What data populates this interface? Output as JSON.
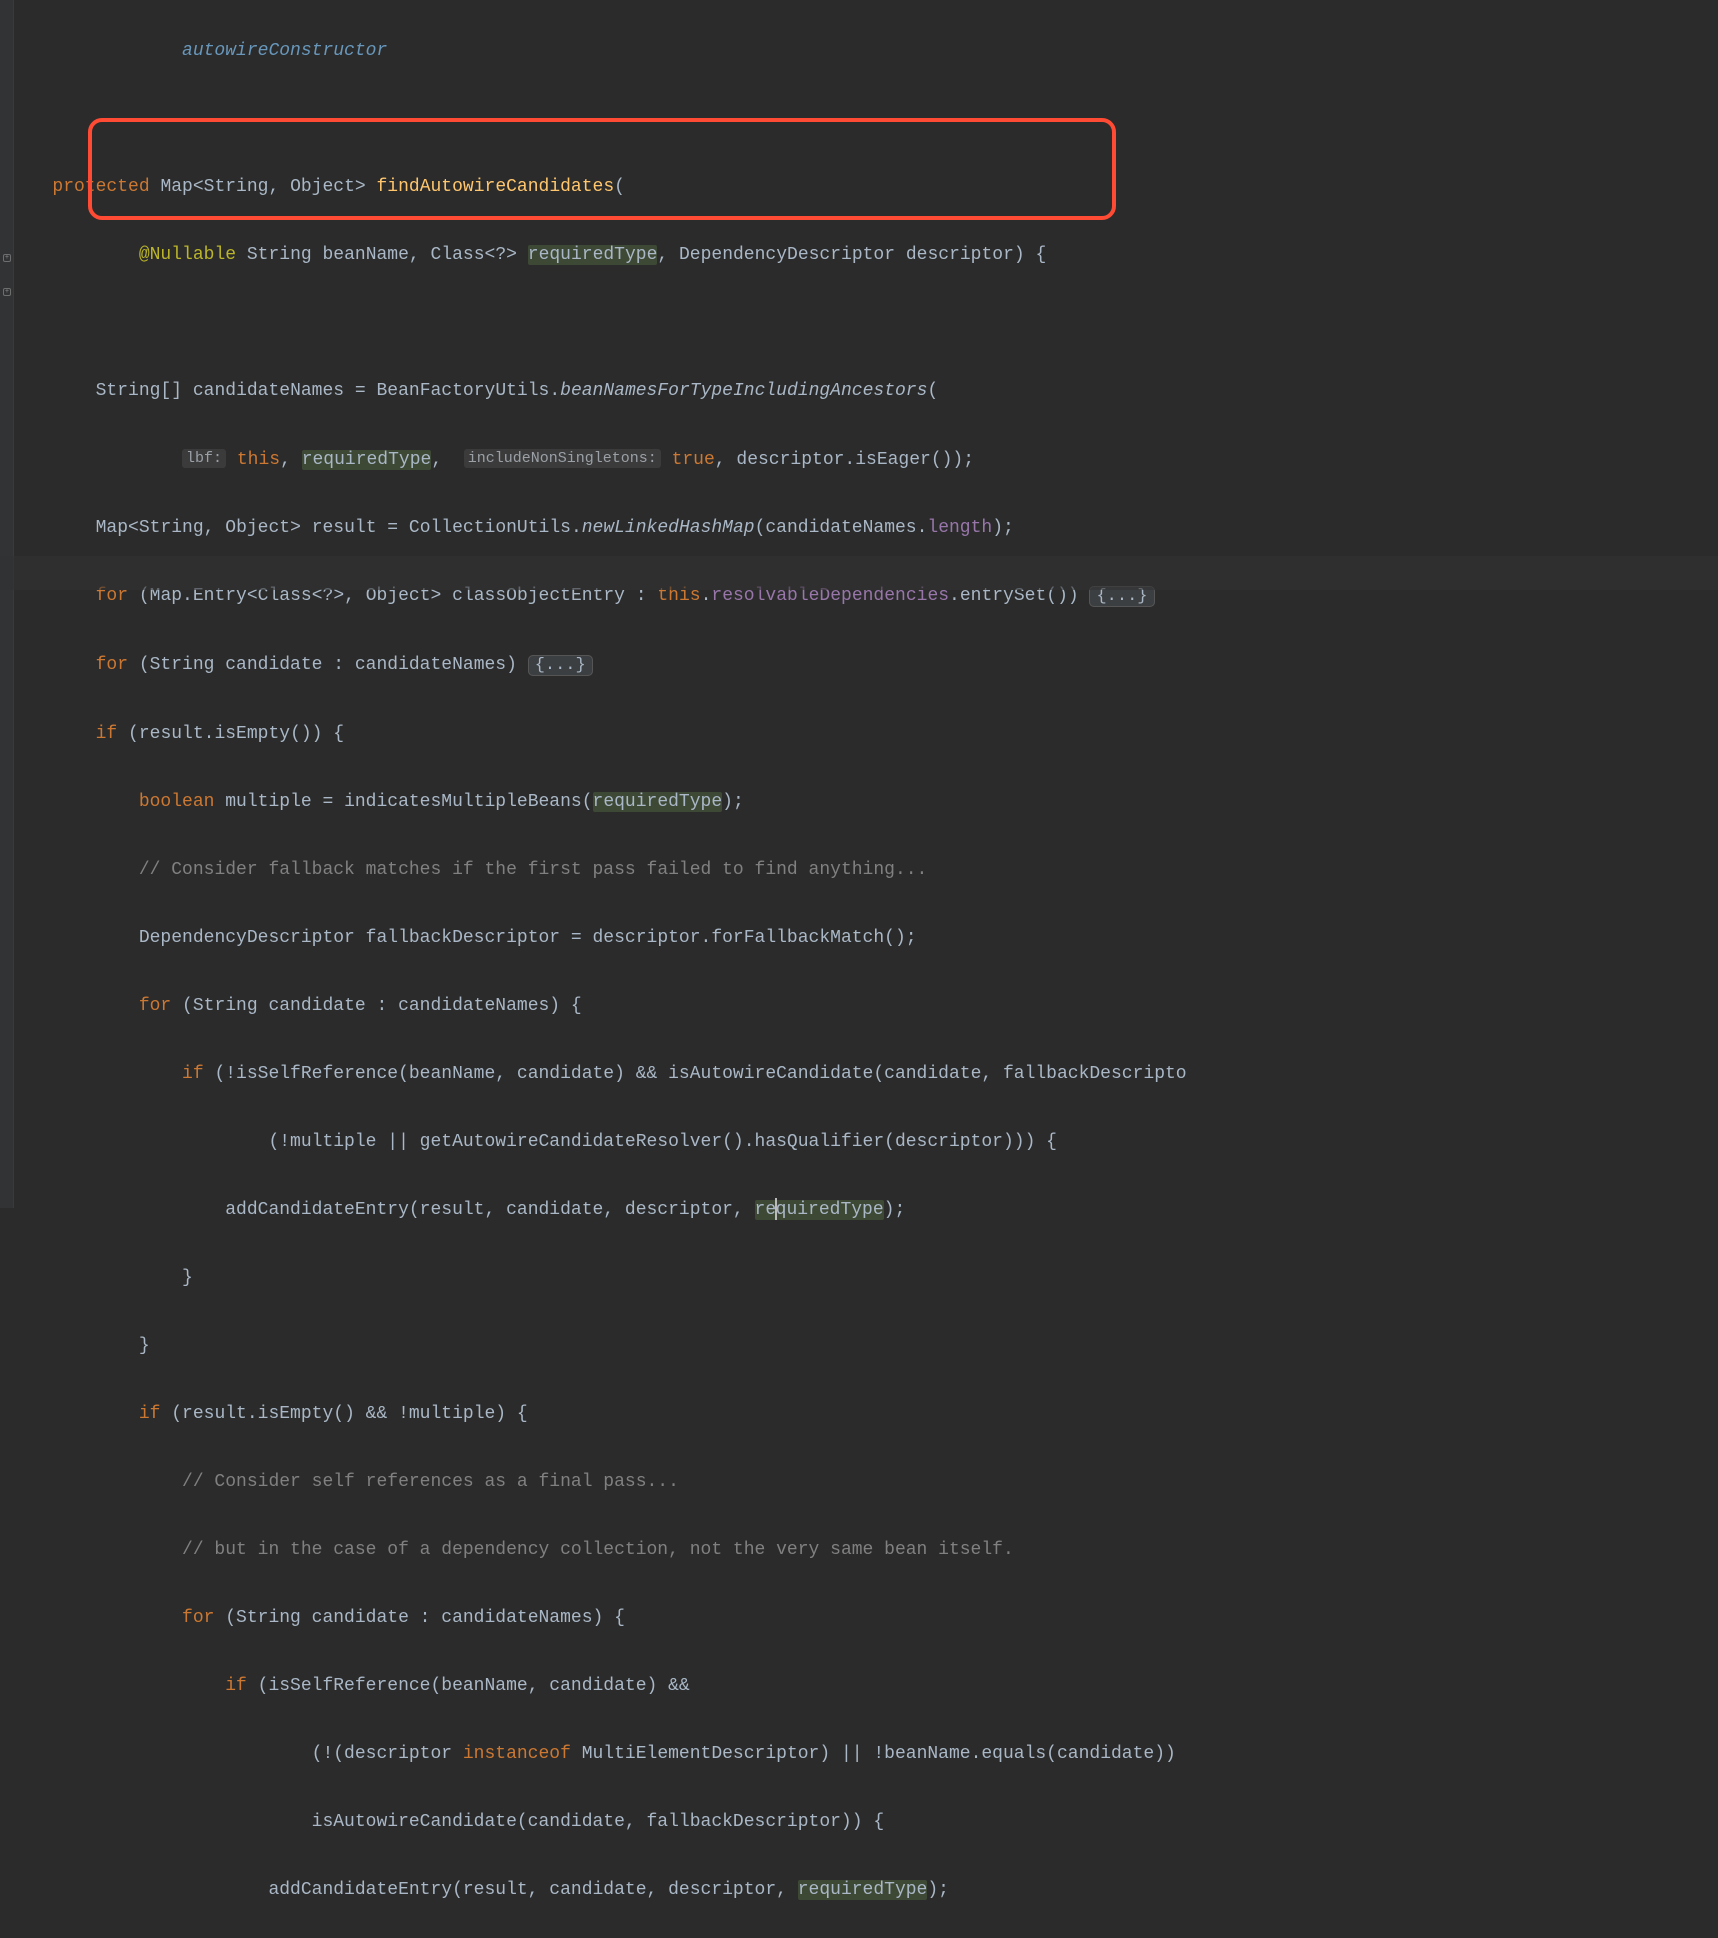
{
  "topLink": "autowireConstructor",
  "l1": {
    "protected": "protected",
    "Map": "Map",
    "String": "String",
    "Object": "Object",
    "method": "findAutowireCandidates",
    "open": "("
  },
  "l2": {
    "nullable": "@Nullable",
    "String": "String",
    "beanName": "beanName",
    "Class": "Class",
    "wildcard": "?",
    "requiredType": "requiredType",
    "DD": "DependencyDescriptor",
    "descriptor": "descriptor",
    "close": ") {"
  },
  "l3": {
    "StringArr": "String[]",
    "var": "candidateNames",
    "eq": " = ",
    "BFU": "BeanFactoryUtils",
    "dot": ".",
    "call": "beanNamesForTypeIncludingAncestors",
    "open": "("
  },
  "l4": {
    "hint1": "lbf:",
    "this": "this",
    "sep1": ", ",
    "requiredType": "requiredType",
    "sep2": ", ",
    "hint2": "includeNonSingletons:",
    "true": "true",
    "sep3": ", descriptor.isEager());"
  },
  "l5": {
    "Map": "Map",
    "String": "String",
    "Object": "Object",
    "var": "result",
    "eq": " = ",
    "CU": "CollectionUtils",
    "dot": ".",
    "call": "newLinkedHashMap",
    "open": "(candidateNames.",
    "len": "length",
    "close": ");"
  },
  "l6": {
    "for": "for",
    "open": " (",
    "MapEntry": "Map.Entry",
    "Class": "Class",
    "wildcard": "?",
    "Object": "Object",
    "var": "classObjectEntry",
    "colon": " : ",
    "this": "this",
    "dot": ".",
    "rd": "resolvableDependencies",
    "tail": ".entrySet()) ",
    "fold": "{...}"
  },
  "l7": {
    "for": "for",
    "rest": " (String candidate : candidateNames) ",
    "fold": "{...}"
  },
  "l8": {
    "if": "if",
    "rest": " (result.isEmpty()) {"
  },
  "l9": {
    "boolean": "boolean",
    "rest1": " multiple = indicatesMultipleBeans(",
    "requiredType": "requiredType",
    "rest2": ");"
  },
  "l10": "// Consider fallback matches if the first pass failed to find anything...",
  "l11": "DependencyDescriptor fallbackDescriptor = descriptor.forFallbackMatch();",
  "l12": {
    "for": "for",
    "rest": " (String candidate : candidateNames) {"
  },
  "l13": {
    "if": "if",
    "rest": " (!isSelfReference(beanName, candidate) && isAutowireCandidate(candidate, fallbackDescripto"
  },
  "l14": "        (!multiple || getAutowireCandidateResolver().hasQualifier(descriptor))) {",
  "l15": {
    "pre": "    addCandidateEntry(result, candidate, descriptor, ",
    "reqA": "re",
    "reqB": "quiredType",
    "tail": ");"
  },
  "l16": "}",
  "l17": "}",
  "l18": {
    "if": "if",
    "rest": " (result.isEmpty() && !multiple) {"
  },
  "l19": "// Consider self references as a final pass...",
  "l20": "// but in the case of a dependency collection, not the very same bean itself.",
  "l21": {
    "for": "for",
    "rest": " (String candidate : candidateNames) {"
  },
  "l22": {
    "if": "if",
    "rest": " (isSelfReference(beanName, candidate) &&"
  },
  "l23": {
    "pre": "        (!(descriptor ",
    "instanceof": "instanceof",
    "post": " MultiElementDescriptor) || !beanName.equals(candidate)) "
  },
  "l24": "        isAutowireCandidate(candidate, fallbackDescriptor)) {",
  "l25": {
    "pre": "    addCandidateEntry(result, candidate, descriptor, ",
    "requiredType": "requiredType",
    "tail": ");"
  }
}
